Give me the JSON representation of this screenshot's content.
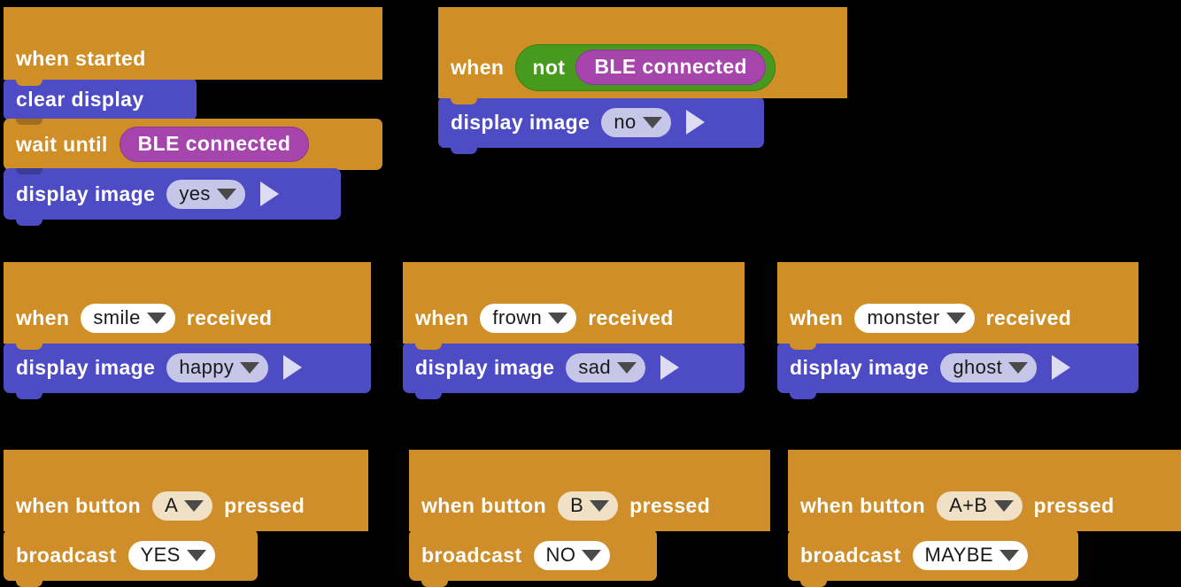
{
  "palette": {
    "background": "#000000",
    "hat_orange": "#cf8e26",
    "stack_blue": "#4d4cc5",
    "reporter_purple": "#a645ab",
    "operator_green": "#469b1e",
    "dropdown_lavender": "#c6c6e8",
    "dropdown_white": "#ffffff",
    "dropdown_cream": "#f0e0c6",
    "text_white": "#ffffff",
    "text_dark": "#1a1a1a",
    "play_arrow": "#dcdcf2"
  },
  "scripts": [
    {
      "id": "startup-script",
      "blocks": [
        {
          "kind": "hat",
          "label": "when started"
        },
        {
          "kind": "stack",
          "label": "clear display"
        },
        {
          "kind": "hat-wide",
          "label": "wait until",
          "reporter": "BLE connected"
        },
        {
          "kind": "stack",
          "label": "display image",
          "dropdown": "yes",
          "play": true
        }
      ]
    },
    {
      "id": "ble-disconnected-script",
      "blocks": [
        {
          "kind": "hat",
          "label": "when",
          "operator": "not",
          "reporter": "BLE connected"
        },
        {
          "kind": "stack",
          "label": "display image",
          "dropdown": "no",
          "play": true
        }
      ]
    },
    {
      "id": "smile-received-script",
      "blocks": [
        {
          "kind": "hat",
          "label_a": "when",
          "dropdown": "smile",
          "label_b": "received"
        },
        {
          "kind": "stack",
          "label": "display image",
          "dropdown": "happy",
          "play": true
        }
      ]
    },
    {
      "id": "frown-received-script",
      "blocks": [
        {
          "kind": "hat",
          "label_a": "when",
          "dropdown": "frown",
          "label_b": "received"
        },
        {
          "kind": "stack",
          "label": "display image",
          "dropdown": "sad",
          "play": true
        }
      ]
    },
    {
      "id": "monster-received-script",
      "blocks": [
        {
          "kind": "hat",
          "label_a": "when",
          "dropdown": "monster",
          "label_b": "received"
        },
        {
          "kind": "stack",
          "label": "display image",
          "dropdown": "ghost",
          "play": true
        }
      ]
    },
    {
      "id": "button-a-script",
      "blocks": [
        {
          "kind": "hat",
          "label_a": "when button",
          "dropdown": "A",
          "label_b": "pressed"
        },
        {
          "kind": "stack",
          "label": "broadcast",
          "dropdown": "YES"
        }
      ]
    },
    {
      "id": "button-b-script",
      "blocks": [
        {
          "kind": "hat",
          "label_a": "when button",
          "dropdown": "B",
          "label_b": "pressed"
        },
        {
          "kind": "stack",
          "label": "broadcast",
          "dropdown": "NO"
        }
      ]
    },
    {
      "id": "button-ab-script",
      "blocks": [
        {
          "kind": "hat",
          "label_a": "when button",
          "dropdown": "A+B",
          "label_b": "pressed"
        },
        {
          "kind": "stack",
          "label": "broadcast",
          "dropdown": "MAYBE"
        }
      ]
    }
  ],
  "text": {
    "when_started": "when started",
    "clear_display": "clear display",
    "wait_until": "wait until",
    "ble_connected": "BLE connected",
    "display_image": "display image",
    "when": "when",
    "not": "not",
    "received": "received",
    "when_button": "when button",
    "pressed": "pressed",
    "broadcast": "broadcast",
    "dd_yes": "yes",
    "dd_no": "no",
    "dd_smile": "smile",
    "dd_happy": "happy",
    "dd_frown": "frown",
    "dd_sad": "sad",
    "dd_monster": "monster",
    "dd_ghost": "ghost",
    "dd_a": "A",
    "dd_b": "B",
    "dd_ab": "A+B",
    "dd_YES": "YES",
    "dd_NO": "NO",
    "dd_MAYBE": "MAYBE"
  }
}
